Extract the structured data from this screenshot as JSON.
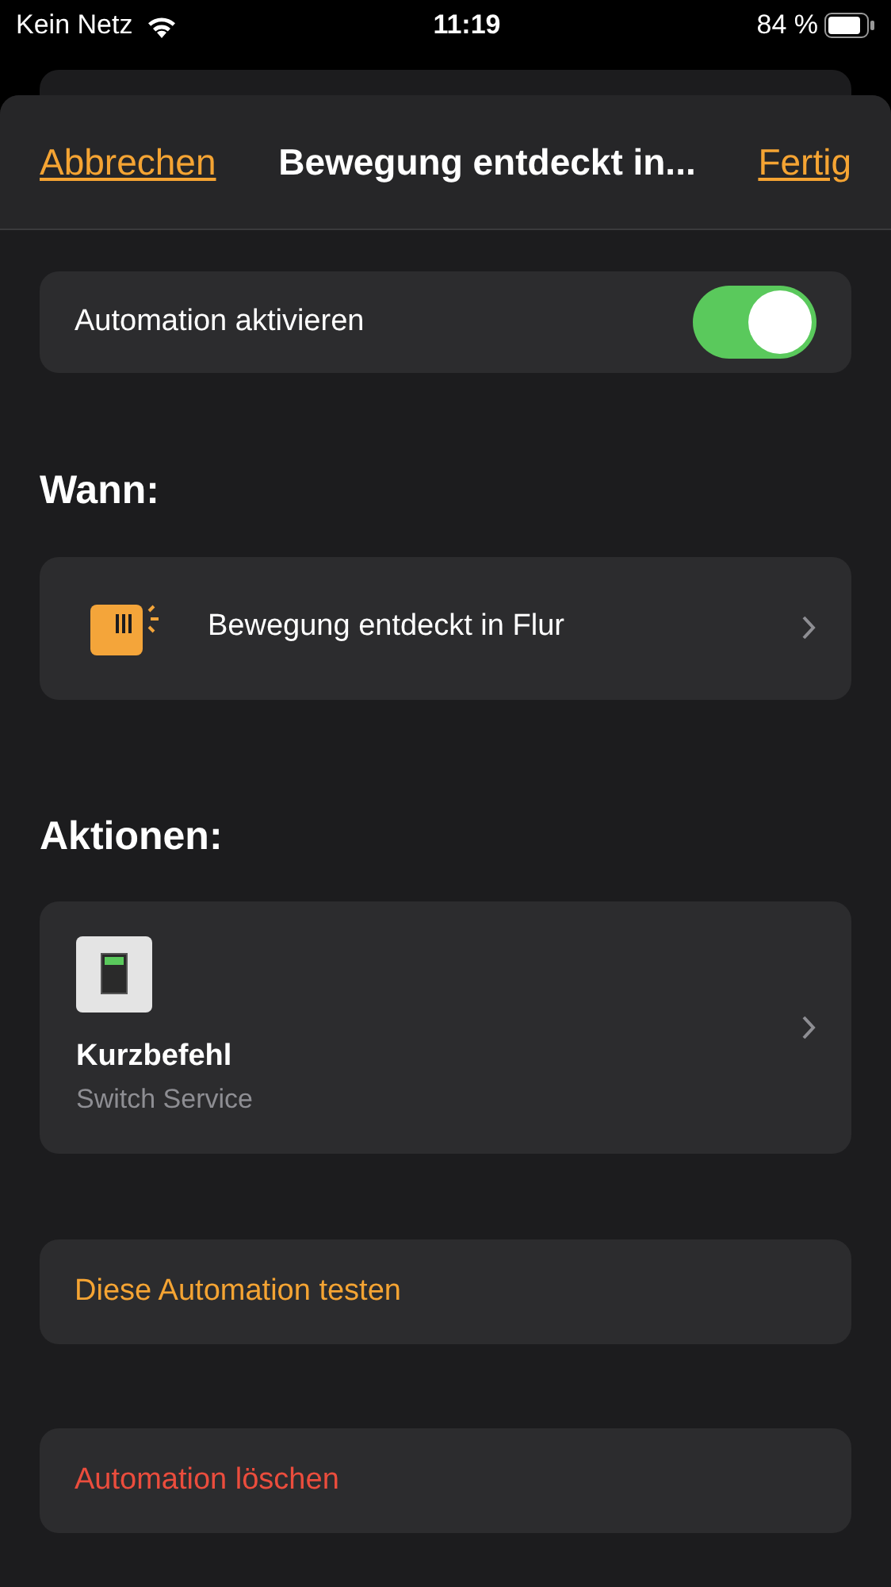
{
  "status_bar": {
    "carrier": "Kein Netz",
    "time": "11:19",
    "battery": "84 %"
  },
  "nav": {
    "cancel": "Abbrechen",
    "title": "Bewegung entdeckt in...",
    "done": "Fertig"
  },
  "enable": {
    "label": "Automation aktivieren",
    "on": true
  },
  "sections": [
    {
      "title": "Wann:",
      "items": [
        {
          "kind": "sensor",
          "label": "Bewegung entdeckt in Flur"
        }
      ]
    },
    {
      "title": "Aktionen:",
      "items": [
        {
          "kind": "shortcut",
          "label": "Kurzbefehl",
          "subtitle": "Switch Service"
        }
      ]
    }
  ],
  "actions": [
    {
      "kind": "test",
      "label": "Diese Automation testen"
    },
    {
      "kind": "delete",
      "label": "Automation löschen"
    }
  ]
}
